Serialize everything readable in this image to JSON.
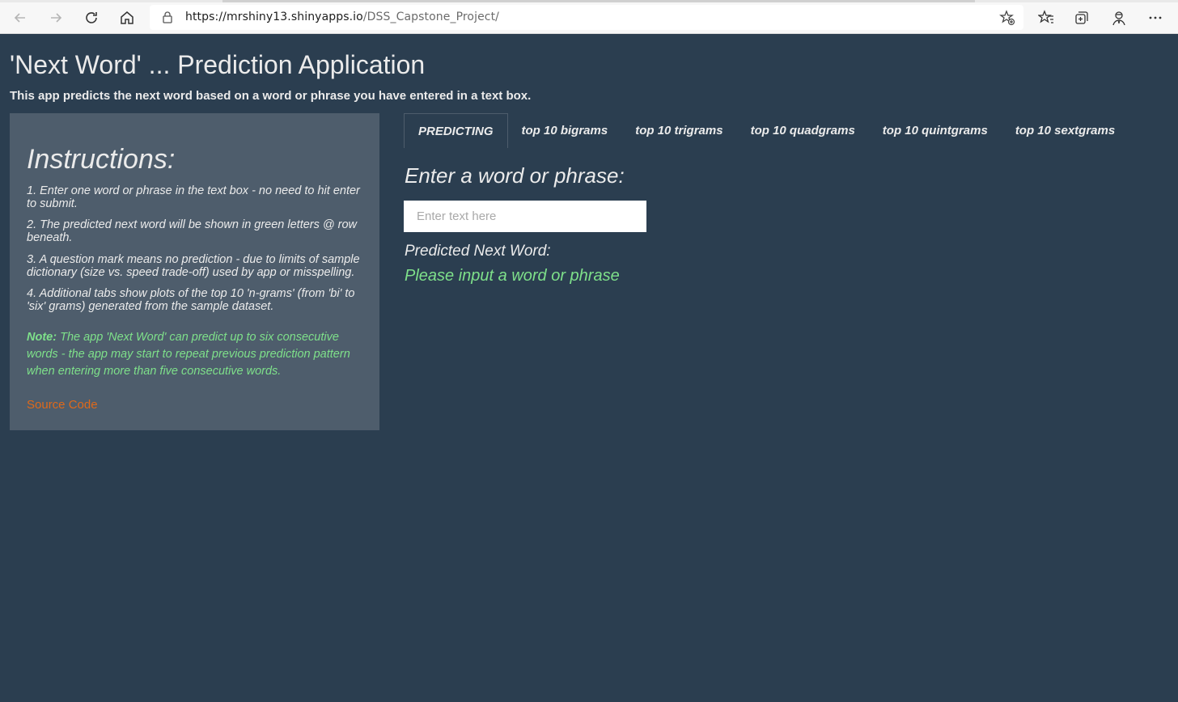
{
  "browser": {
    "url_host": "https://mrshiny13.shinyapps.io",
    "url_path": "/DSS_Capstone_Project/"
  },
  "app": {
    "title": "'Next Word' ... Prediction Application",
    "subtitle": "This app predicts the next word based on a word or phrase you have entered in a text box."
  },
  "sidebar": {
    "heading": "Instructions:",
    "instructions": [
      "1. Enter one word or phrase in the text box - no need to hit enter to submit.",
      "2. The predicted next word will be shown in green letters @ row beneath.",
      "3. A question mark means no prediction - due to limits of sample dictionary (size vs. speed trade-off) used by app or misspelling.",
      "4. Additional tabs show plots of the top 10 'n-grams' (from 'bi' to 'six' grams) generated from the sample dataset."
    ],
    "note_label": "Note:",
    "note_text": " The app 'Next Word' can predict up to six consecutive words - the app may start to repeat previous prediction pattern when entering more than five consecutive words.",
    "source_link": "Source Code"
  },
  "tabs": [
    {
      "label": "PREDICTING",
      "active": true
    },
    {
      "label": "top 10 bigrams",
      "active": false
    },
    {
      "label": "top 10 trigrams",
      "active": false
    },
    {
      "label": "top 10 quadgrams",
      "active": false
    },
    {
      "label": "top 10 quintgrams",
      "active": false
    },
    {
      "label": "top 10 sextgrams",
      "active": false
    }
  ],
  "main": {
    "enter_label": "Enter a word or phrase:",
    "input_value": "",
    "input_placeholder": "Enter text here",
    "predicted_label": "Predicted Next Word:",
    "predicted_value": "Please input a word or phrase"
  },
  "colors": {
    "background": "#2b3e50",
    "sidebar": "#4e5d6c",
    "accent_green": "#7ee08a",
    "link_orange": "#df691a"
  }
}
